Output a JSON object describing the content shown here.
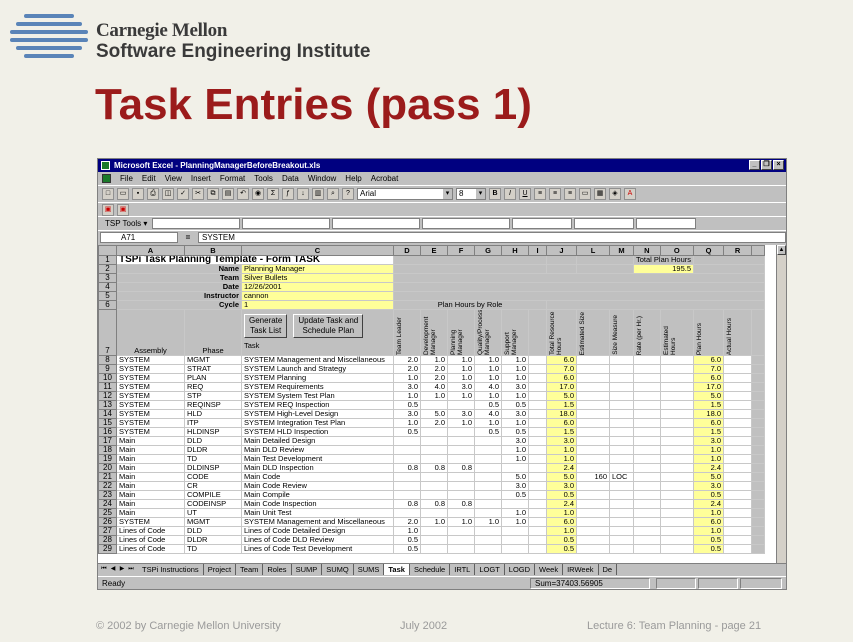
{
  "header": {
    "org_line1": "Carnegie Mellon",
    "org_line2": "Software Engineering Institute",
    "title": "Task Entries (pass 1)"
  },
  "footer": {
    "copyright": "© 2002 by Carnegie Mellon University",
    "date": "July 2002",
    "page": "Lecture 6: Team Planning - page 21"
  },
  "excel": {
    "window_title": "Microsoft Excel - PlanningManagerBeforeBreakout.xls",
    "menu": [
      "File",
      "Edit",
      "View",
      "Insert",
      "Format",
      "Tools",
      "Data",
      "Window",
      "Help",
      "Acrobat"
    ],
    "font_name": "Arial",
    "font_size": "8",
    "tsp_tools": "TSP Tools ▾",
    "name_box": "A71",
    "formula_eq": "=",
    "formula_value": "SYSTEM",
    "columns": [
      "A",
      "B",
      "C",
      "D",
      "E",
      "F",
      "G",
      "H",
      "I",
      "J",
      "L",
      "M",
      "N",
      "O",
      "Q",
      "R"
    ],
    "sheet_title": "TSPi Task Planning Template - Form TASK",
    "labels": {
      "name": "Name",
      "team": "Team",
      "date": "Date",
      "instructor": "Instructor",
      "cycle": "Cycle",
      "total_plan_hours": "Total Plan Hours",
      "plan_hours_by_role": "Plan Hours by Role"
    },
    "values": {
      "name": "Planning Manager",
      "team": "Silver Bullets",
      "date": "12/26/2001",
      "instructor": "cannon",
      "cycle": "1",
      "total_plan_hours": "195.5"
    },
    "buttons": {
      "generate_1": "Generate",
      "generate_2": "Task List",
      "update_1": "Update Task  and",
      "update_2": "Schedule Plan"
    },
    "headers": {
      "assembly": "Assembly",
      "phase": "Phase",
      "task": "Task",
      "team_leader": "Team Leader",
      "development_manager": "Development Manager",
      "planning_manager": "Planning Manager",
      "quality_process_manager": "Quality/Process Manager",
      "support_manager": "Support Manager",
      "total_resource_hours": "Total Resource Hours",
      "estimated_size": "Estimated Size",
      "size_measure": "Size Measure",
      "rate": "Rate (per Hr.)",
      "estimated_hours": "Estimated Hours",
      "plan_hours": "Plan Hours",
      "actual_hours": "Actual Hours"
    },
    "rows": [
      {
        "n": "8",
        "a": "SYSTEM",
        "p": "MGMT",
        "t": "SYSTEM Management and Miscellaneous",
        "d": "2.0",
        "e": "1.0",
        "f": "1.0",
        "g": "1.0",
        "h": "1.0",
        "j": "6.0",
        "l": "",
        "m": "",
        "q": "6.0"
      },
      {
        "n": "9",
        "a": "SYSTEM",
        "p": "STRAT",
        "t": "SYSTEM Launch and Strategy",
        "d": "2.0",
        "e": "2.0",
        "f": "1.0",
        "g": "1.0",
        "h": "1.0",
        "j": "7.0",
        "l": "",
        "m": "",
        "q": "7.0"
      },
      {
        "n": "10",
        "a": "SYSTEM",
        "p": "PLAN",
        "t": "SYSTEM Planning",
        "d": "1.0",
        "e": "2.0",
        "f": "1.0",
        "g": "1.0",
        "h": "1.0",
        "j": "6.0",
        "l": "",
        "m": "",
        "q": "6.0"
      },
      {
        "n": "11",
        "a": "SYSTEM",
        "p": "REQ",
        "t": "SYSTEM Requirements",
        "d": "3.0",
        "e": "4.0",
        "f": "3.0",
        "g": "4.0",
        "h": "3.0",
        "j": "17.0",
        "l": "",
        "m": "",
        "q": "17.0"
      },
      {
        "n": "12",
        "a": "SYSTEM",
        "p": "STP",
        "t": "SYSTEM System Test Plan",
        "d": "1.0",
        "e": "1.0",
        "f": "1.0",
        "g": "1.0",
        "h": "1.0",
        "j": "5.0",
        "l": "",
        "m": "",
        "q": "5.0"
      },
      {
        "n": "13",
        "a": "SYSTEM",
        "p": "REQINSP",
        "t": "SYSTEM REQ Inspection",
        "d": "0.5",
        "e": "",
        "f": "",
        "g": "0.5",
        "h": "0.5",
        "j": "1.5",
        "l": "",
        "m": "",
        "q": "1.5"
      },
      {
        "n": "14",
        "a": "SYSTEM",
        "p": "HLD",
        "t": "SYSTEM High-Level Design",
        "d": "3.0",
        "e": "5.0",
        "f": "3.0",
        "g": "4.0",
        "h": "3.0",
        "j": "18.0",
        "l": "",
        "m": "",
        "q": "18.0"
      },
      {
        "n": "15",
        "a": "SYSTEM",
        "p": "ITP",
        "t": "SYSTEM Integration Test Plan",
        "d": "1.0",
        "e": "2.0",
        "f": "1.0",
        "g": "1.0",
        "h": "1.0",
        "j": "6.0",
        "l": "",
        "m": "",
        "q": "6.0"
      },
      {
        "n": "16",
        "a": "SYSTEM",
        "p": "HLDINSP",
        "t": "SYSTEM HLD Inspection",
        "d": "0.5",
        "e": "",
        "f": "",
        "g": "0.5",
        "h": "0.5",
        "j": "1.5",
        "l": "",
        "m": "",
        "q": "1.5"
      },
      {
        "n": "17",
        "a": "Main",
        "p": "DLD",
        "t": "Main Detailed Design",
        "d": "",
        "e": "",
        "f": "",
        "g": "",
        "h": "3.0",
        "j": "3.0",
        "l": "",
        "m": "",
        "q": "3.0"
      },
      {
        "n": "18",
        "a": "Main",
        "p": "DLDR",
        "t": "Main DLD Review",
        "d": "",
        "e": "",
        "f": "",
        "g": "",
        "h": "1.0",
        "j": "1.0",
        "l": "",
        "m": "",
        "q": "1.0"
      },
      {
        "n": "19",
        "a": "Main",
        "p": "TD",
        "t": "Main Test Development",
        "d": "",
        "e": "",
        "f": "",
        "g": "",
        "h": "1.0",
        "j": "1.0",
        "l": "",
        "m": "",
        "q": "1.0"
      },
      {
        "n": "20",
        "a": "Main",
        "p": "DLDINSP",
        "t": "Main DLD Inspection",
        "d": "0.8",
        "e": "0.8",
        "f": "0.8",
        "g": "",
        "h": "",
        "j": "2.4",
        "l": "",
        "m": "",
        "q": "2.4"
      },
      {
        "n": "21",
        "a": "Main",
        "p": "CODE",
        "t": "Main Code",
        "d": "",
        "e": "",
        "f": "",
        "g": "",
        "h": "5.0",
        "j": "5.0",
        "l": "160",
        "m": "LOC",
        "q": "5.0"
      },
      {
        "n": "22",
        "a": "Main",
        "p": "CR",
        "t": "Main Code Review",
        "d": "",
        "e": "",
        "f": "",
        "g": "",
        "h": "3.0",
        "j": "3.0",
        "l": "",
        "m": "",
        "q": "3.0"
      },
      {
        "n": "23",
        "a": "Main",
        "p": "COMPILE",
        "t": "Main Compile",
        "d": "",
        "e": "",
        "f": "",
        "g": "",
        "h": "0.5",
        "j": "0.5",
        "l": "",
        "m": "",
        "q": "0.5"
      },
      {
        "n": "24",
        "a": "Main",
        "p": "CODEINSP",
        "t": "Main Code Inspection",
        "d": "0.8",
        "e": "0.8",
        "f": "0.8",
        "g": "",
        "h": "",
        "j": "2.4",
        "l": "",
        "m": "",
        "q": "2.4"
      },
      {
        "n": "25",
        "a": "Main",
        "p": "UT",
        "t": "Main Unit Test",
        "d": "",
        "e": "",
        "f": "",
        "g": "",
        "h": "1.0",
        "j": "1.0",
        "l": "",
        "m": "",
        "q": "1.0"
      },
      {
        "n": "26",
        "a": "SYSTEM",
        "p": "MGMT",
        "t": "SYSTEM Management and Miscellaneous",
        "d": "2.0",
        "e": "1.0",
        "f": "1.0",
        "g": "1.0",
        "h": "1.0",
        "j": "6.0",
        "l": "",
        "m": "",
        "q": "6.0"
      },
      {
        "n": "27",
        "a": "Lines of Code",
        "p": "DLD",
        "t": "Lines of Code Detailed Design",
        "d": "1.0",
        "e": "",
        "f": "",
        "g": "",
        "h": "",
        "j": "1.0",
        "l": "",
        "m": "",
        "q": "1.0"
      },
      {
        "n": "28",
        "a": "Lines of Code",
        "p": "DLDR",
        "t": "Lines of Code DLD Review",
        "d": "0.5",
        "e": "",
        "f": "",
        "g": "",
        "h": "",
        "j": "0.5",
        "l": "",
        "m": "",
        "q": "0.5"
      },
      {
        "n": "29",
        "a": "Lines of Code",
        "p": "TD",
        "t": "Lines of Code Test Development",
        "d": "0.5",
        "e": "",
        "f": "",
        "g": "",
        "h": "",
        "j": "0.5",
        "l": "",
        "m": "",
        "q": "0.5"
      }
    ],
    "sheet_tabs": [
      "TSPi Instructions",
      "Project",
      "Team",
      "Roles",
      "SUMP",
      "SUMQ",
      "SUMS",
      "Task",
      "Schedule",
      "IRTL",
      "LOGT",
      "LOGD",
      "Week",
      "IRWeek",
      "De"
    ],
    "active_tab": "Task",
    "status": "Ready",
    "sum": "Sum=37403.56905"
  }
}
